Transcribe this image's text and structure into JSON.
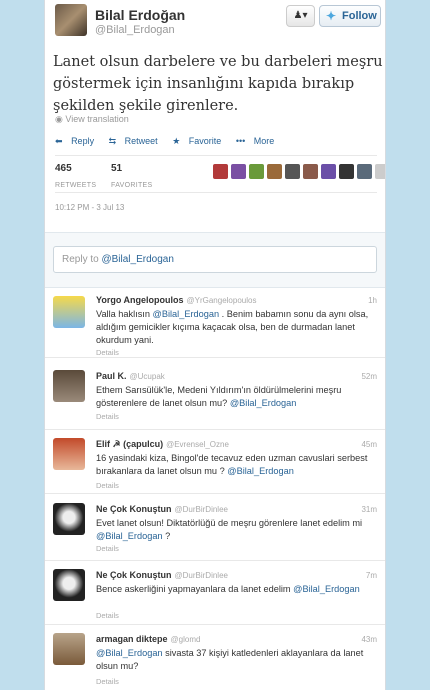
{
  "tweet": {
    "name": "Bilal Erdoğan",
    "handle": "@Bilal_Erdogan",
    "follow_label": "Follow",
    "user_menu_label": "▾",
    "text": "Lanet olsun darbelere ve bu darbeleri meşru göstermek için insanlığını kapıda bırakıp şekilden şekile girenlere.",
    "view_translation": "View translation",
    "actions": {
      "reply": "Reply",
      "retweet": "Retweet",
      "favorite": "Favorite",
      "more": "More"
    },
    "stats": {
      "retweets_count": "465",
      "retweets_label": "RETWEETS",
      "favorites_count": "51",
      "favorites_label": "FAVORITES"
    },
    "date": "10:12 PM - 3 Jul 13"
  },
  "reply_box": {
    "prefix": "Reply to ",
    "mention": "@Bilal_Erdogan"
  },
  "replies": [
    {
      "name": "Yorgo Angelopoulos",
      "handle": "@YrGangelopoulos",
      "time": "1h",
      "text_parts": [
        "Valla haklısın ",
        "@Bilal_Erdogan",
        " . Benim babamın sonu da aynı olsa, aldığım gemicikler kıçıma kaçacak olsa, ben de durmadan lanet okurdum yani."
      ],
      "details": "Details"
    },
    {
      "name": "Paul K.",
      "handle": "@Ucupak",
      "time": "52m",
      "text_parts": [
        "Ethem Sarısülük'le, Medeni Yıldırım'ın öldürülmelerini meşru gösterenlere de lanet olsun mu? ",
        "@Bilal_Erdogan",
        ""
      ],
      "details": "Details"
    },
    {
      "name": "Elif ☭ (çapulcu)",
      "handle": "@Evrensel_Ozne",
      "time": "45m",
      "text_parts": [
        "16 yasindaki kiza, Bingol'de tecavuz eden uzman cavuslari serbest bırakanlara da lanet olsun mu ? ",
        "@Bilal_Erdogan",
        ""
      ],
      "details": "Details"
    },
    {
      "name": "Ne Çok Konuştun",
      "handle": "@DurBirDinlee",
      "time": "31m",
      "text_parts": [
        "Evet lanet olsun! Diktatörlüğü de meşru görenlere lanet edelim mi ",
        "@Bilal_Erdogan",
        " ?"
      ],
      "details": "Details"
    },
    {
      "name": "Ne Çok Konuştun",
      "handle": "@DurBirDinlee",
      "time": "7m",
      "text_parts": [
        "Bence askerliğini yapmayanlara da lanet edelim ",
        "@Bilal_Erdogan",
        ""
      ],
      "details": "Details"
    },
    {
      "name": "armagan diktepe",
      "handle": "@glomd",
      "time": "43m",
      "text_parts": [
        "",
        "@Bilal_Erdogan",
        " sivasta 37 kişiyi katledenleri aklayanlara da lanet olsun mu?"
      ],
      "details": "Details"
    }
  ],
  "icons": {
    "globe": "globe-icon",
    "reply": "reply-arrow-icon",
    "retweet": "retweet-icon",
    "favorite": "star-icon",
    "more": "more-dots-icon",
    "follow": "bird-icon",
    "user": "user-icon"
  },
  "colors": {
    "background": "#c0deed",
    "link": "#2a6496",
    "accent": "#4da7de"
  }
}
